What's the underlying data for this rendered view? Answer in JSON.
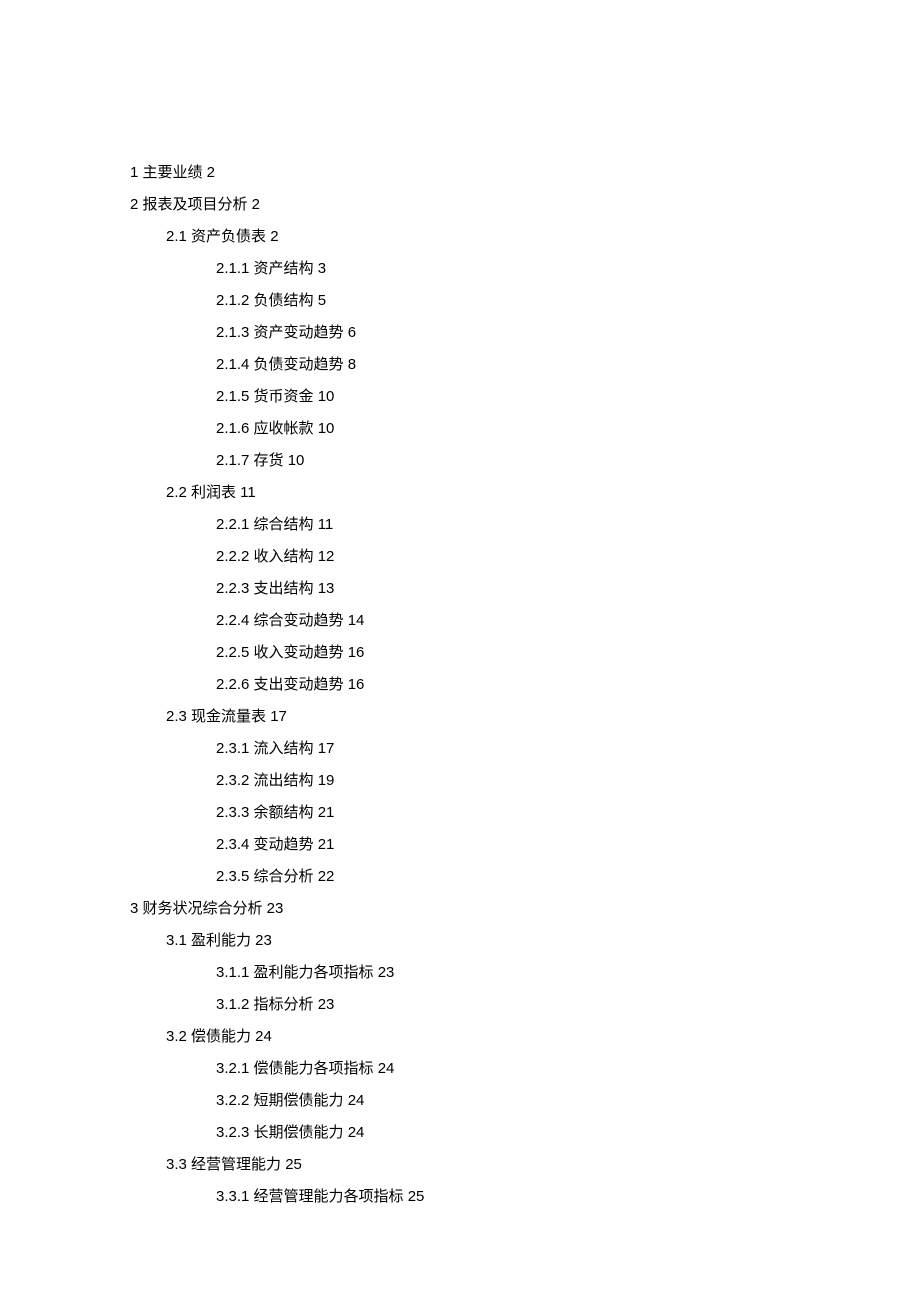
{
  "toc": [
    {
      "level": 0,
      "text": "1 主要业绩 2"
    },
    {
      "level": 0,
      "text": "2 报表及项目分析 2"
    },
    {
      "level": 1,
      "text": "2.1 资产负债表 2"
    },
    {
      "level": 2,
      "text": "2.1.1 资产结构 3"
    },
    {
      "level": 2,
      "text": "2.1.2 负债结构 5"
    },
    {
      "level": 2,
      "text": "2.1.3 资产变动趋势 6"
    },
    {
      "level": 2,
      "text": "2.1.4 负债变动趋势 8"
    },
    {
      "level": 2,
      "text": "2.1.5 货币资金 10"
    },
    {
      "level": 2,
      "text": "2.1.6 应收帐款 10"
    },
    {
      "level": 2,
      "text": "2.1.7 存货 10"
    },
    {
      "level": 1,
      "text": "2.2 利润表 11"
    },
    {
      "level": 2,
      "text": "2.2.1 综合结构 11"
    },
    {
      "level": 2,
      "text": "2.2.2 收入结构 12"
    },
    {
      "level": 2,
      "text": "2.2.3 支出结构 13"
    },
    {
      "level": 2,
      "text": "2.2.4 综合变动趋势 14"
    },
    {
      "level": 2,
      "text": "2.2.5 收入变动趋势 16"
    },
    {
      "level": 2,
      "text": "2.2.6 支出变动趋势 16"
    },
    {
      "level": 1,
      "text": "2.3 现金流量表 17"
    },
    {
      "level": 2,
      "text": "2.3.1 流入结构 17"
    },
    {
      "level": 2,
      "text": "2.3.2 流出结构 19"
    },
    {
      "level": 2,
      "text": "2.3.3 余额结构 21"
    },
    {
      "level": 2,
      "text": "2.3.4 变动趋势 21"
    },
    {
      "level": 2,
      "text": "2.3.5 综合分析 22"
    },
    {
      "level": 0,
      "text": "3 财务状况综合分析 23"
    },
    {
      "level": 1,
      "text": "3.1 盈利能力 23"
    },
    {
      "level": 2,
      "text": "3.1.1 盈利能力各项指标 23"
    },
    {
      "level": 2,
      "text": "3.1.2 指标分析 23"
    },
    {
      "level": 1,
      "text": "3.2 偿债能力 24"
    },
    {
      "level": 2,
      "text": "3.2.1 偿债能力各项指标 24"
    },
    {
      "level": 2,
      "text": "3.2.2 短期偿债能力 24"
    },
    {
      "level": 2,
      "text": "3.2.3 长期偿债能力 24"
    },
    {
      "level": 1,
      "text": "3.3 经营管理能力 25"
    },
    {
      "level": 2,
      "text": "3.3.1 经营管理能力各项指标 25"
    }
  ]
}
